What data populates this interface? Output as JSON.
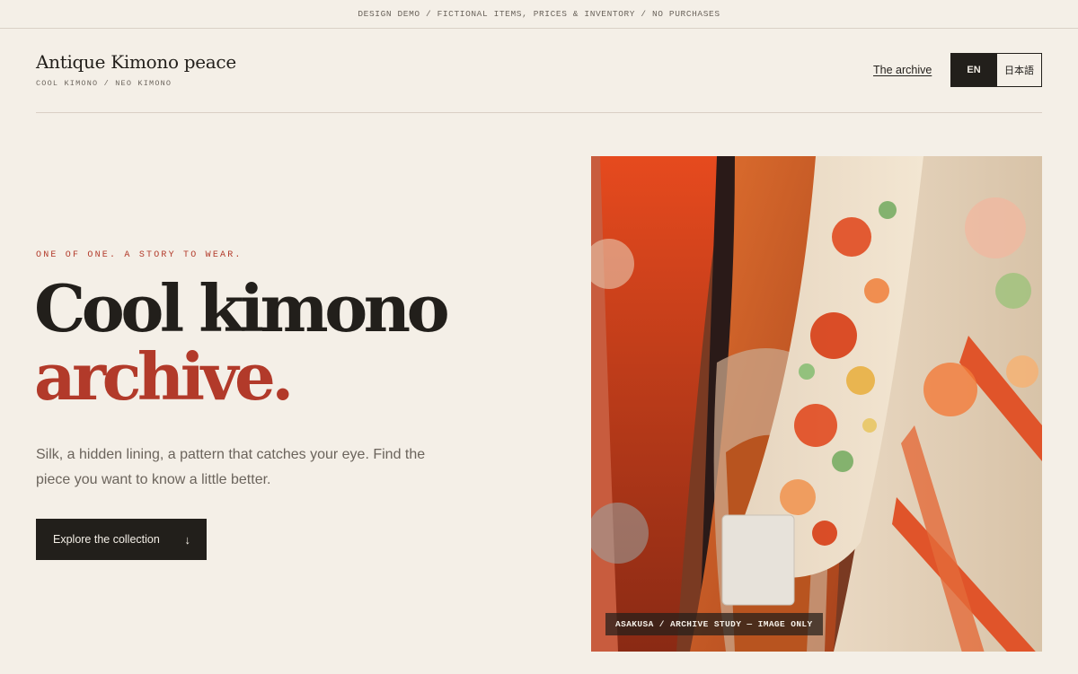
{
  "banner": {
    "text": "DESIGN DEMO / FICTIONAL ITEMS, PRICES & INVENTORY / NO PURCHASES"
  },
  "brand": {
    "title": "Antique Kimono peace",
    "subtitle": "COOL KIMONO / NEO KIMONO"
  },
  "nav": {
    "archive_link": "The archive",
    "languages": [
      {
        "label": "EN",
        "active": true
      },
      {
        "label": "日本語",
        "active": false
      }
    ]
  },
  "hero": {
    "eyebrow": "ONE OF ONE. A STORY TO WEAR.",
    "headline_line1": "Cool kimono",
    "headline_line2": "archive.",
    "lede": "Silk, a hidden lining, a pattern that catches your eye. Find the piece you want to know a little better.",
    "cta_label": "Explore the collection",
    "cta_icon": "arrow-down-icon",
    "image_caption": "ASAKUSA / ARCHIVE STUDY — IMAGE ONLY"
  },
  "colors": {
    "background": "#f4efe7",
    "ink": "#221f1b",
    "accent": "#b23a2a",
    "muted": "#6b645c"
  }
}
